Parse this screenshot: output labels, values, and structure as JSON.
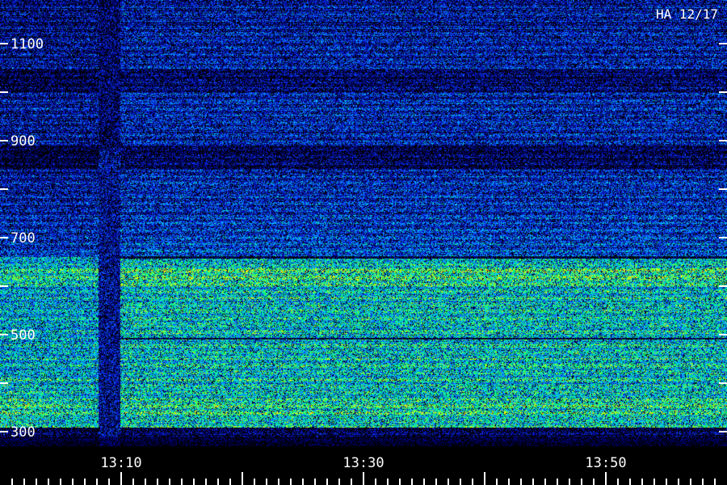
{
  "title": "HA 12/17",
  "chart_data": {
    "type": "heatmap",
    "title": "HA 12/17",
    "xlabel": "",
    "ylabel": "",
    "x_tick_labels": [
      "13:10",
      "13:30",
      "13:50"
    ],
    "x_ticks_minutes": [
      790,
      810,
      830
    ],
    "x_range_minutes": [
      780,
      839
    ],
    "y_tick_labels": [
      "300",
      "500",
      "700",
      "900",
      "1100"
    ],
    "y_ticks": [
      300,
      500,
      700,
      900,
      1100
    ],
    "y_minor_ticks": [
      400,
      600,
      800,
      1000
    ],
    "y_range": [
      280,
      1210
    ],
    "colormap": [
      "#000000",
      "#0000a0",
      "#1040ff",
      "#00c8ff",
      "#00ff60",
      "#ffff00",
      "#ff6000"
    ],
    "features": {
      "strong_emission_band": [
        310,
        660
      ],
      "weaker_emission_band": [
        670,
        840
      ],
      "dark_gap_band": [
        850,
        880
      ],
      "faint_band_upper": [
        890,
        1210
      ],
      "horizontal_dark_lines": [
        493,
        660
      ],
      "dark_column_time": "13:08"
    }
  }
}
